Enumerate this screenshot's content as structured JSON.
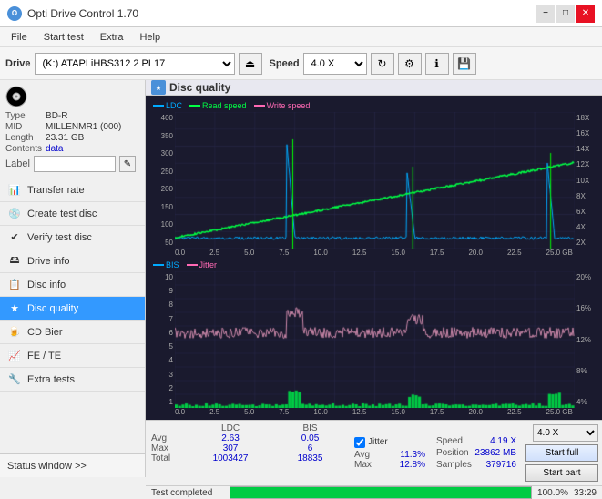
{
  "app": {
    "title": "Opti Drive Control 1.70",
    "logo": "O"
  },
  "titlebar": {
    "title": "Opti Drive Control 1.70",
    "minimize": "−",
    "maximize": "□",
    "close": "✕"
  },
  "menubar": {
    "items": [
      "File",
      "Start test",
      "Extra",
      "Help"
    ]
  },
  "toolbar": {
    "drive_label": "Drive",
    "drive_value": "(K:)  ATAPI iHBS312  2 PL17",
    "speed_label": "Speed",
    "speed_value": "4.0 X"
  },
  "disc": {
    "type_label": "Type",
    "type_value": "BD-R",
    "mid_label": "MID",
    "mid_value": "MILLENMR1 (000)",
    "length_label": "Length",
    "length_value": "23.31 GB",
    "contents_label": "Contents",
    "contents_value": "data",
    "label_label": "Label"
  },
  "nav": {
    "items": [
      {
        "id": "transfer-rate",
        "label": "Transfer rate",
        "icon": "📊"
      },
      {
        "id": "create-test-disc",
        "label": "Create test disc",
        "icon": "💿"
      },
      {
        "id": "verify-test-disc",
        "label": "Verify test disc",
        "icon": "✔"
      },
      {
        "id": "drive-info",
        "label": "Drive info",
        "icon": "ℹ"
      },
      {
        "id": "disc-info",
        "label": "Disc info",
        "icon": "📋"
      },
      {
        "id": "disc-quality",
        "label": "Disc quality",
        "icon": "★",
        "active": true
      },
      {
        "id": "cd-bier",
        "label": "CD Bier",
        "icon": "🍺"
      },
      {
        "id": "fe-te",
        "label": "FE / TE",
        "icon": "📈"
      },
      {
        "id": "extra-tests",
        "label": "Extra tests",
        "icon": "🔧"
      }
    ],
    "status_window": "Status window >>",
    "status_text": "Test completed"
  },
  "chart": {
    "title": "Disc quality",
    "legend": {
      "ldc": "LDC",
      "read": "Read speed",
      "write": "Write speed",
      "bis": "BIS",
      "jitter": "Jitter"
    },
    "top": {
      "y_max": 400,
      "y_labels_left": [
        "400",
        "350",
        "300",
        "250",
        "200",
        "150",
        "100",
        "50"
      ],
      "y_labels_right": [
        "18X",
        "16X",
        "14X",
        "12X",
        "10X",
        "8X",
        "6X",
        "4X",
        "2X"
      ],
      "x_labels": [
        "0.0",
        "2.5",
        "5.0",
        "7.5",
        "10.0",
        "12.5",
        "15.0",
        "17.5",
        "20.0",
        "22.5",
        "25.0 GB"
      ]
    },
    "bottom": {
      "y_max": 10,
      "y_labels_left": [
        "10",
        "9",
        "8",
        "7",
        "6",
        "5",
        "4",
        "3",
        "2",
        "1"
      ],
      "y_labels_right": [
        "20%",
        "16%",
        "12%",
        "8%",
        "4%"
      ],
      "x_labels": [
        "0.0",
        "2.5",
        "5.0",
        "7.5",
        "10.0",
        "12.5",
        "15.0",
        "17.5",
        "20.0",
        "22.5",
        "25.0 GB"
      ]
    }
  },
  "stats": {
    "headers": [
      "",
      "LDC",
      "BIS",
      "",
      "Jitter",
      "Speed",
      ""
    ],
    "avg_label": "Avg",
    "avg_ldc": "2.63",
    "avg_bis": "0.05",
    "avg_jitter": "11.3%",
    "avg_speed": "4.19 X",
    "max_label": "Max",
    "max_ldc": "307",
    "max_bis": "6",
    "max_jitter": "12.8%",
    "total_label": "Total",
    "total_ldc": "1003427",
    "total_bis": "18835",
    "position_label": "Position",
    "position_value": "23862 MB",
    "samples_label": "Samples",
    "samples_value": "379716",
    "jitter_checked": true,
    "speed_select": "4.0 X",
    "start_full": "Start full",
    "start_part": "Start part"
  },
  "progress": {
    "value": 100,
    "text": "100.0%",
    "time": "33:29",
    "status": "Test completed"
  }
}
